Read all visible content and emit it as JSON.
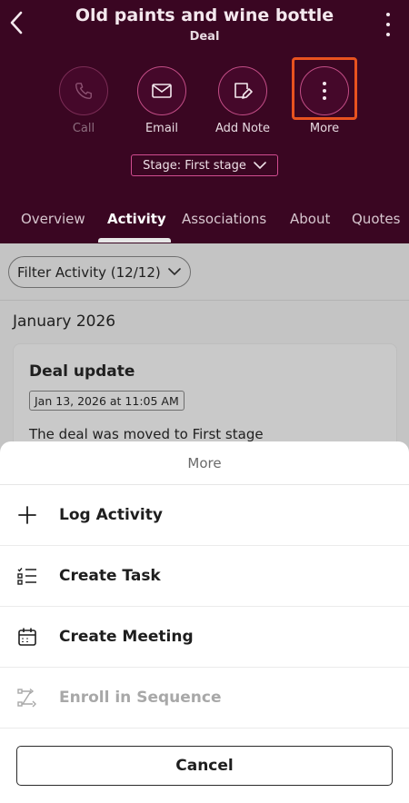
{
  "header": {
    "title": "Old paints and wine bottle",
    "subtitle": "Deal",
    "back_icon": "chevron-left-icon",
    "menu_icon": "kebab-menu-icon"
  },
  "actions": [
    {
      "label": "Call",
      "icon": "phone-icon",
      "disabled": true
    },
    {
      "label": "Email",
      "icon": "envelope-icon",
      "disabled": false
    },
    {
      "label": "Add Note",
      "icon": "note-edit-icon",
      "disabled": false
    },
    {
      "label": "More",
      "icon": "vertical-dots-icon",
      "disabled": false,
      "highlighted": true
    }
  ],
  "stage": {
    "label": "Stage: First stage"
  },
  "tabs": [
    {
      "label": "Overview",
      "active": false
    },
    {
      "label": "Activity",
      "active": true
    },
    {
      "label": "Associations",
      "active": false
    },
    {
      "label": "About",
      "active": false
    },
    {
      "label": "Quotes",
      "active": false
    }
  ],
  "activity": {
    "filter_label": "Filter Activity (12/12)",
    "month": "January 2026",
    "card": {
      "title": "Deal update",
      "date": "Jan 13, 2026 at 11:05 AM",
      "text": "The deal was moved to First stage"
    }
  },
  "sheet": {
    "title": "More",
    "items": [
      {
        "label": "Log Activity",
        "icon": "plus-icon",
        "disabled": false
      },
      {
        "label": "Create Task",
        "icon": "checklist-icon",
        "disabled": false
      },
      {
        "label": "Create Meeting",
        "icon": "calendar-icon",
        "disabled": false
      },
      {
        "label": "Enroll in Sequence",
        "icon": "sequence-icon",
        "disabled": true
      }
    ],
    "cancel_label": "Cancel"
  },
  "colors": {
    "header_bg": "#3a0622",
    "accent": "#c24d86",
    "highlight": "#e8521f"
  }
}
